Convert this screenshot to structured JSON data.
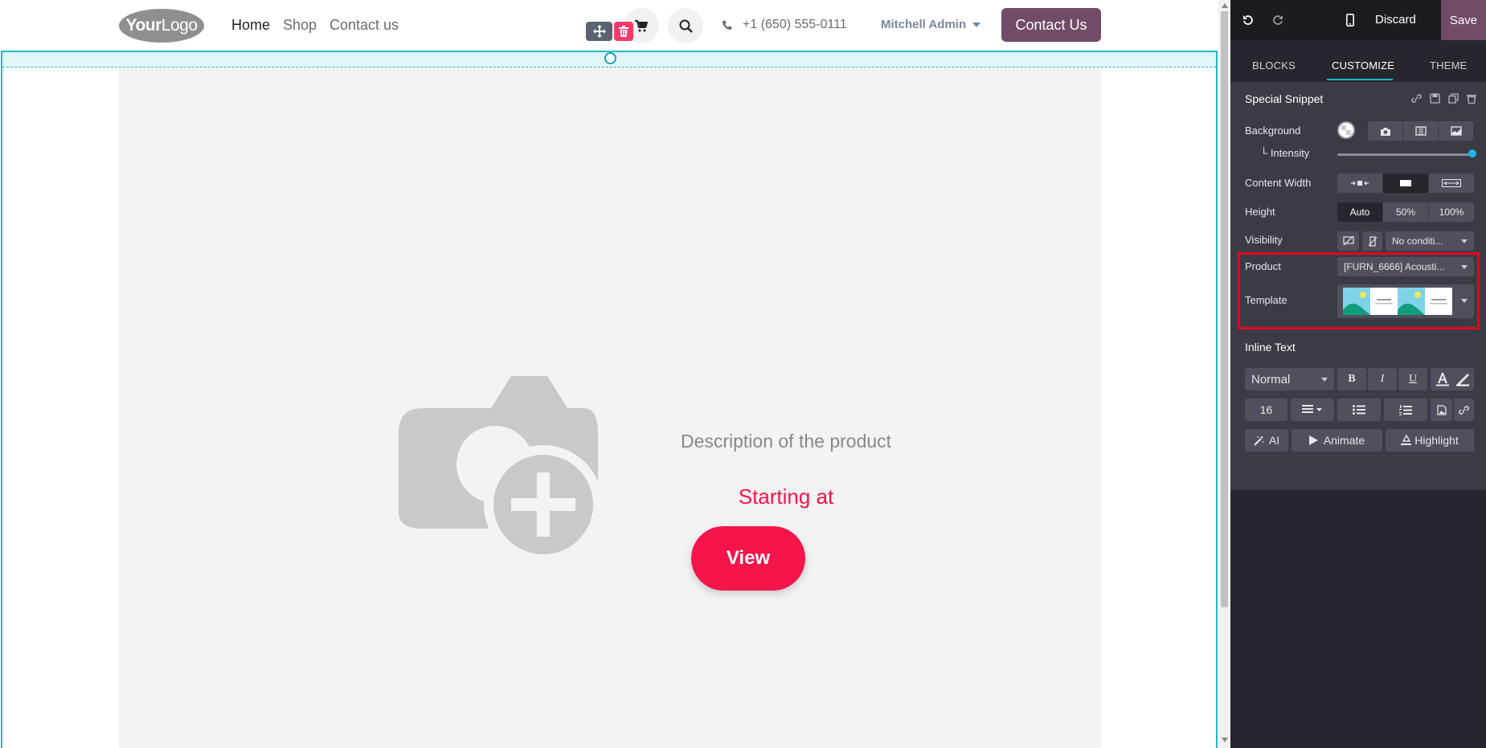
{
  "site": {
    "logo": {
      "bold": "Your",
      "light": "Logo"
    },
    "nav": [
      "Home",
      "Shop",
      "Contact us"
    ],
    "phone": "+1 (650) 555-0111",
    "user": "Mitchell Admin",
    "cta": "Contact Us"
  },
  "snippet": {
    "description": "Description of the product",
    "price_label": "Starting at",
    "view_button": "View"
  },
  "editor": {
    "discard": "Discard",
    "save": "Save",
    "tabs": [
      "BLOCKS",
      "CUSTOMIZE",
      "THEME"
    ],
    "active_tab": "CUSTOMIZE",
    "snippet_title": "Special Snippet",
    "options": {
      "background": "Background",
      "intensity": "└ Intensity",
      "content_width": "Content Width",
      "height": "Height",
      "height_options": [
        "Auto",
        "50%",
        "100%"
      ],
      "visibility": "Visibility",
      "visibility_select": "No conditi...",
      "product": "Product",
      "product_value": "[FURN_6666] Acousti...",
      "template": "Template"
    },
    "intensity_level_percent": 100,
    "inline_text": {
      "title": "Inline Text",
      "style_select": "Normal",
      "font_size": "16",
      "ai": "AI",
      "animate": "Animate",
      "highlight": "Highlight"
    }
  },
  "colors": {
    "brand": "#714b67",
    "accent_red": "#f5154a",
    "selection": "#20b8c8"
  }
}
